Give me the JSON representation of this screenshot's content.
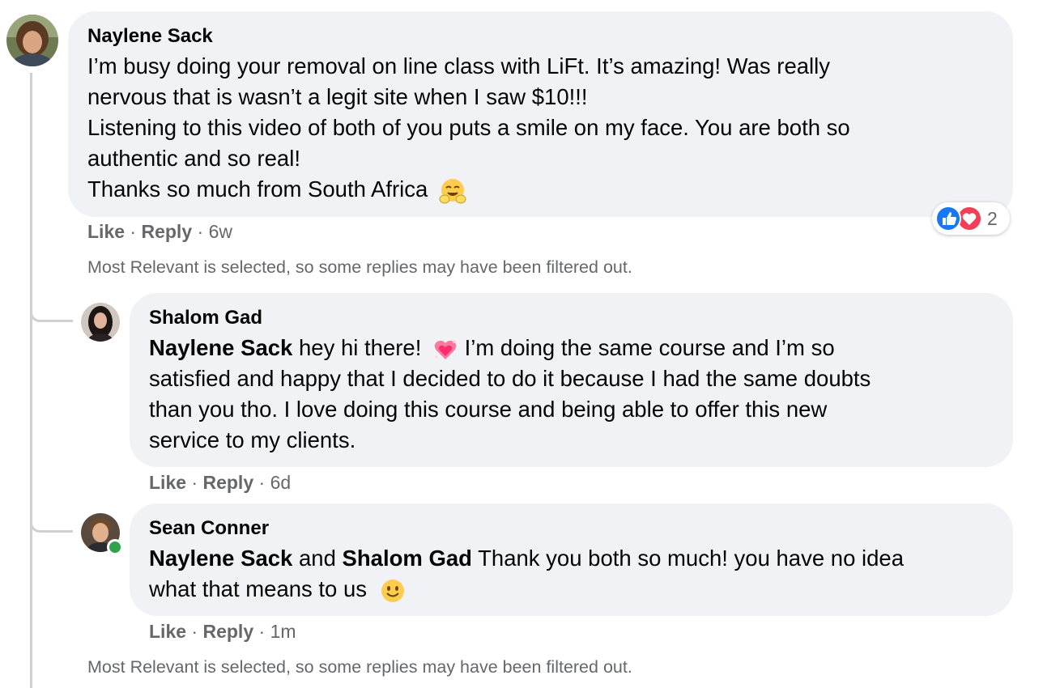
{
  "comments": [
    {
      "author": "Naylene Sack",
      "lines": [
        "I’m busy doing your removal on line class with LiFt. It’s amazing! Was really",
        "nervous that is wasn’t a legit site when I saw $10!!!",
        "Listening to this video of both of you puts a smile on my face. You are both so",
        "authentic and so real!",
        "Thanks so much from South Africa"
      ],
      "like": "Like",
      "reply": "Reply",
      "time": "6w",
      "reaction_count": "2",
      "reaction_icons": [
        "like-icon",
        "love-icon"
      ],
      "emoji": "hugging-face-emoji"
    },
    {
      "author": "Shalom Gad",
      "mention": "Naylene Sack",
      "lines": [
        " hey hi there!",
        " I’m doing the same course and I’m so",
        "satisfied and happy that I decided to do it because I had the same doubts",
        "than you tho. I love doing this course and being able to offer this new",
        "service to my clients."
      ],
      "like": "Like",
      "reply": "Reply",
      "time": "6d",
      "emoji": "sparkling-heart-emoji"
    },
    {
      "author": "Sean Conner",
      "mention1": "Naylene Sack",
      "conj": " and ",
      "mention2": "Shalom Gad",
      "lines": [
        " Thank you both so much! you have no idea",
        "what that means to us"
      ],
      "like": "Like",
      "reply": "Reply",
      "time": "1m",
      "emoji": "smiling-face-emoji"
    }
  ],
  "filter_notice": "Most Relevant is selected, so some replies may have been filtered out.",
  "separator": " · ",
  "colors": {
    "bubble": "#f0f2f5",
    "secondary_text": "#65676b",
    "like_blue": "#1877f2",
    "love_red": "#f33e58",
    "online_green": "#31a24c"
  }
}
